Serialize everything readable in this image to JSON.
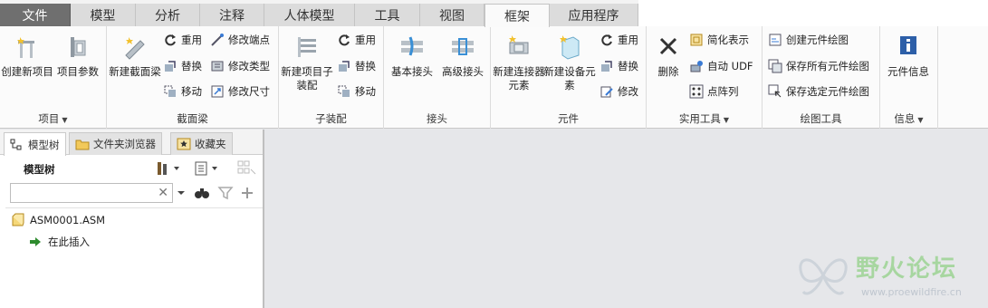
{
  "tabs": [
    {
      "label": "文件"
    },
    {
      "label": "模型"
    },
    {
      "label": "分析"
    },
    {
      "label": "注释"
    },
    {
      "label": "人体模型"
    },
    {
      "label": "工具"
    },
    {
      "label": "视图"
    },
    {
      "label": "框架"
    },
    {
      "label": "应用程序"
    }
  ],
  "active_tab": "框架",
  "ribbon": {
    "project": {
      "label": "项目",
      "create_project": "创建新项目",
      "project_params": "项目参数"
    },
    "section_beam": {
      "label": "截面梁",
      "new_section_beam": "新建截面梁",
      "reuse": "重用",
      "replace": "替换",
      "move": "移动",
      "modify_endpoint": "修改端点",
      "modify_type": "修改类型",
      "modify_size": "修改尺寸"
    },
    "subassembly": {
      "label": "子装配",
      "new_sub": "新建项目子装配",
      "reuse": "重用",
      "replace": "替换",
      "move": "移动"
    },
    "joint": {
      "label": "接头",
      "basic": "基本接头",
      "advanced": "高级接头"
    },
    "element": {
      "label": "元件",
      "new_connector": "新建连接器元素",
      "new_equipment": "新建设备元素",
      "reuse": "重用",
      "replace": "替换",
      "modify": "修改"
    },
    "utility": {
      "label": "实用工具",
      "delete": "删除",
      "simplify": "简化表示",
      "auto_udf": "自动 UDF",
      "pattern": "点阵列"
    },
    "drawing": {
      "label": "绘图工具",
      "create_drawing": "创建元件绘图",
      "save_all": "保存所有元件绘图",
      "save_selected": "保存选定元件绘图"
    },
    "info": {
      "label": "信息",
      "element_info": "元件信息"
    }
  },
  "left_panel": {
    "tabs": [
      "模型树",
      "文件夹浏览器",
      "收藏夹"
    ],
    "tree_title": "模型树",
    "search_value": "",
    "tree_items": [
      "ASM0001.ASM",
      "在此插入"
    ]
  },
  "watermark": {
    "title": "野火论坛",
    "url": "www.proewildfire.cn"
  }
}
